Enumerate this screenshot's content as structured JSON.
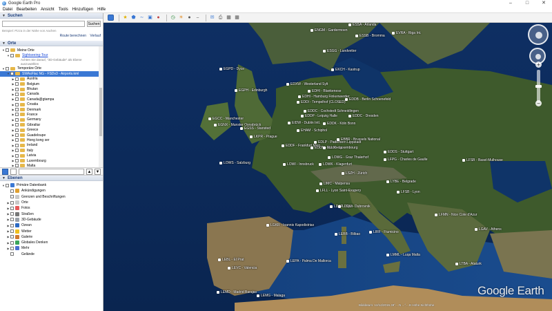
{
  "window": {
    "title": "Google Earth Pro"
  },
  "menu": [
    "Datei",
    "Bearbeiten",
    "Ansicht",
    "Tools",
    "Hinzufügen",
    "Hilfe"
  ],
  "search": {
    "header": "Suchen",
    "button_label": "Suchen",
    "hint": "Beispiel: Pizza in der Nähe von Aachen",
    "route_label": "Route berechnen",
    "history_label": "Verlauf"
  },
  "places": {
    "header": "Orte",
    "items": [
      {
        "label": "Meine Orte",
        "level": 0,
        "kind": "folder"
      },
      {
        "label": "Sightseeing-Tour",
        "level": 1,
        "kind": "link"
      },
      {
        "label": "Achten Sie darauf, \"3D-Gebäude\" als Ebene",
        "level": 2,
        "kind": "note"
      },
      {
        "label": "auszuwählen",
        "level": 2,
        "kind": "note"
      },
      {
        "label": "Temporäre Orte",
        "level": 0,
        "kind": "folder"
      },
      {
        "label": "SWAsFlac NG - FSDv3 - Airports.kml",
        "level": 1,
        "kind": "selected"
      },
      {
        "label": "Austria",
        "level": 2,
        "kind": "folder"
      },
      {
        "label": "Belgium",
        "level": 2,
        "kind": "folder"
      },
      {
        "label": "Bhutan",
        "level": 2,
        "kind": "folder"
      },
      {
        "label": "Canada",
        "level": 2,
        "kind": "folder"
      },
      {
        "label": "Canada@gtampa",
        "level": 2,
        "kind": "folder"
      },
      {
        "label": "Croatia",
        "level": 2,
        "kind": "folder"
      },
      {
        "label": "Denmark",
        "level": 2,
        "kind": "folder"
      },
      {
        "label": "France",
        "level": 2,
        "kind": "folder"
      },
      {
        "label": "Germany",
        "level": 2,
        "kind": "folder"
      },
      {
        "label": "Gibraltar",
        "level": 2,
        "kind": "folder"
      },
      {
        "label": "Greece",
        "level": 2,
        "kind": "folder"
      },
      {
        "label": "Guadeloupe",
        "level": 2,
        "kind": "folder"
      },
      {
        "label": "Hong kong ser",
        "level": 2,
        "kind": "folder"
      },
      {
        "label": "Ireland",
        "level": 2,
        "kind": "folder"
      },
      {
        "label": "Italy",
        "level": 2,
        "kind": "folder"
      },
      {
        "label": "Latvia",
        "level": 2,
        "kind": "folder"
      },
      {
        "label": "Luxembourg",
        "level": 2,
        "kind": "folder"
      },
      {
        "label": "Malta",
        "level": 2,
        "kind": "folder"
      }
    ]
  },
  "layers": {
    "header": "Ebenen",
    "items": [
      {
        "label": "Primäre Datenbank",
        "color": "#3a78d4"
      },
      {
        "label": "Ankündigungen",
        "color": "#e0a030"
      },
      {
        "label": "Grenzen und Beschriftungen",
        "color": "#c8c8c8"
      },
      {
        "label": "Orte",
        "color": "#c8c8c8"
      },
      {
        "label": "Fotos",
        "color": "#e65a5a"
      },
      {
        "label": "Straßen",
        "color": "#777777"
      },
      {
        "label": "3D-Gebäude",
        "color": "#9aa0a8"
      },
      {
        "label": "Ozean",
        "color": "#2d6bc4"
      },
      {
        "label": "Wetter",
        "color": "#f0c020"
      },
      {
        "label": "Galerie",
        "color": "#d07a30"
      },
      {
        "label": "Globales Denken",
        "color": "#3aa55a"
      },
      {
        "label": "Mehr",
        "color": "#4a6fd0"
      },
      {
        "label": "Gelände",
        "color": "#ffffff"
      }
    ]
  },
  "map": {
    "logo": "Google Earth",
    "status": "Bilddatum: 12/14/2015   49°... N   ...°... E   Höhe   Sichthöhe",
    "placemarks": [
      "ESSA - Arlanda",
      "ENGM - Gardermoen",
      "EVRA - Riga Int.",
      "ESSB - Bromma",
      "ESGG - Landvetter",
      "EKCH - Kastrup",
      "EGPD - Dyce",
      "EGPH - Edinburgh",
      "EDXW - Westerland Sylt",
      "EDHI - Blankenese",
      "EDHI - Hamburg Finkenwerder",
      "EDDI - Tempelhof (CLOSED)",
      "EDDB - Berlin Schoenefeld",
      "EDDC - Cochstedt Schneidlingen",
      "EDDP - Leipzig Halle",
      "EDDC - Dresden",
      "EGCC - Manchester",
      "EGNX - Munster Osnabrück",
      "EIDW - Dublin Intl.",
      "EHAM - Schiphol",
      "EDDK - Köln Bonn",
      "EDLP - Paderborn Lippstadt",
      "EGSS - Stansted",
      "LKPR - Prague",
      "EBBR - Brussels National",
      "EDDF - Frankfurt Main",
      "EDDN - Nurnberg",
      "ELLX - Luxembourg",
      "EDDS - Stuttgart",
      "LOWS - Salzburg",
      "LOWG - Graz Thalerhof",
      "LFPG - Charles de Gaulle",
      "LOWI - Innsbruck",
      "LOWK - Klagenfurt",
      "LFSB - Basel-Mulhouse",
      "LSZH - Zürich",
      "LYBE - Belgrade",
      "LFSB - Lyon",
      "LDSP - Split",
      "LDDU - Dubrovnik",
      "LFMN - Nice Cote d'Azur",
      "LIRF - Fiumicino",
      "LGKR - Ioannis Kapodistrias",
      "LEBB - Bilbao",
      "LEBL - El Prat",
      "LEPA - Palma De Mallorca",
      "LEMD - Madrid Barajas",
      "LEVC - Valencia",
      "LEMG - Malaga",
      "LMML - Luqa Malta",
      "LGAV - Athens",
      "LTBA - Ataturk",
      "LIMC - Malpensa",
      "LFLL - Lyon Saint-Exupery"
    ]
  },
  "colors": {
    "ocean": "#0b2a5a",
    "land": "#3f5a2c",
    "selection": "#3a78d4"
  }
}
